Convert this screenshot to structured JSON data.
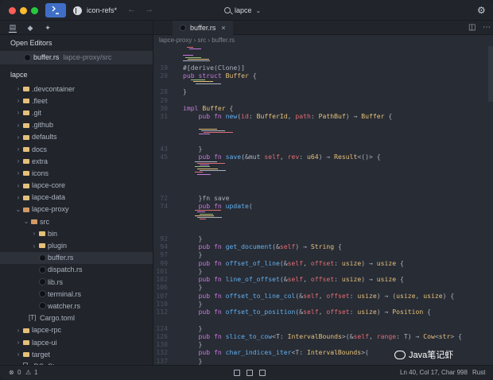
{
  "titlebar": {
    "branch": "icon-refs*",
    "palette_label": "lapce",
    "back_glyph": "←",
    "forward_glyph": "→",
    "settings_glyph": "⚙"
  },
  "sidebar": {
    "tabs": [
      "file-explorer",
      "source-control",
      "plugins"
    ],
    "open_editors_title": "Open Editors",
    "open_editor": {
      "name": "buffer.rs",
      "path": "lapce-proxy/src"
    },
    "root": "lapce",
    "tree": [
      {
        "label": ".devcontainer",
        "kind": "folder",
        "depth": 0,
        "open": false
      },
      {
        "label": ".fleet",
        "kind": "folder",
        "depth": 0,
        "open": false
      },
      {
        "label": ".git",
        "kind": "folder",
        "depth": 0,
        "open": false
      },
      {
        "label": ".github",
        "kind": "folder",
        "depth": 0,
        "open": false
      },
      {
        "label": "defaults",
        "kind": "folder",
        "depth": 0,
        "open": false
      },
      {
        "label": "docs",
        "kind": "folder",
        "depth": 0,
        "open": false
      },
      {
        "label": "extra",
        "kind": "folder",
        "depth": 0,
        "open": false
      },
      {
        "label": "icons",
        "kind": "folder",
        "depth": 0,
        "open": false
      },
      {
        "label": "lapce-core",
        "kind": "folder",
        "depth": 0,
        "open": false
      },
      {
        "label": "lapce-data",
        "kind": "folder",
        "depth": 0,
        "open": false
      },
      {
        "label": "lapce-proxy",
        "kind": "folder",
        "depth": 0,
        "open": true
      },
      {
        "label": "src",
        "kind": "folder",
        "depth": 1,
        "open": true
      },
      {
        "label": "bin",
        "kind": "folder",
        "depth": 2,
        "open": false
      },
      {
        "label": "plugin",
        "kind": "folder",
        "depth": 2,
        "open": false
      },
      {
        "label": "buffer.rs",
        "kind": "rust",
        "depth": 2,
        "selected": true
      },
      {
        "label": "dispatch.rs",
        "kind": "rust",
        "depth": 2
      },
      {
        "label": "lib.rs",
        "kind": "rust",
        "depth": 2
      },
      {
        "label": "terminal.rs",
        "kind": "rust",
        "depth": 2
      },
      {
        "label": "watcher.rs",
        "kind": "rust",
        "depth": 2
      },
      {
        "label": "Cargo.toml",
        "kind": "toml",
        "depth": 1
      },
      {
        "label": "lapce-rpc",
        "kind": "folder",
        "depth": 0,
        "open": false
      },
      {
        "label": "lapce-ui",
        "kind": "folder",
        "depth": 0,
        "open": false
      },
      {
        "label": "target",
        "kind": "folder",
        "depth": 0,
        "open": false
      },
      {
        "label": ".DS_Store",
        "kind": "file",
        "depth": 0
      }
    ]
  },
  "editor": {
    "tab_label": "buffer.rs",
    "close_glyph": "×",
    "breadcrumb": "lapce-proxy › src › buffer.rs",
    "lines": [
      {
        "n": "19",
        "code": [
          [
            "#[derive(Clone)]",
            ""
          ]
        ],
        "row": 2
      },
      {
        "n": "20",
        "code": [
          [
            "pub ",
            "kw"
          ],
          [
            "struct ",
            "kw"
          ],
          [
            "Buffer",
            "ty"
          ],
          [
            " {",
            ""
          ]
        ],
        "row": 3
      },
      {
        "n": "28",
        "code": [
          [
            "}",
            ""
          ]
        ],
        "row": 5
      },
      {
        "n": "29",
        "code": [
          [
            "",
            ""
          ]
        ],
        "row": 6
      },
      {
        "n": "30",
        "code": [
          [
            "impl ",
            "kw"
          ],
          [
            "Buffer",
            "ty"
          ],
          [
            " {",
            ""
          ]
        ],
        "row": 7
      },
      {
        "n": "31",
        "code": [
          [
            "    pub ",
            "kw"
          ],
          [
            "fn ",
            "kw"
          ],
          [
            "new",
            "fn"
          ],
          [
            "(",
            ""
          ],
          [
            "id",
            "pa"
          ],
          [
            ": ",
            ""
          ],
          [
            "BufferId",
            "ty"
          ],
          [
            ", ",
            ""
          ],
          [
            "path",
            "pa"
          ],
          [
            ": ",
            ""
          ],
          [
            "PathBuf",
            "ty"
          ],
          [
            ") → ",
            ""
          ],
          [
            "Buffer",
            "ty"
          ],
          [
            " {",
            ""
          ]
        ],
        "row": 8
      },
      {
        "n": "43",
        "code": [
          [
            "    }",
            ""
          ]
        ],
        "row": 12
      },
      {
        "n": "45",
        "code": [
          [
            "    pub ",
            "kw"
          ],
          [
            "fn ",
            "kw"
          ],
          [
            "save",
            "fn"
          ],
          [
            "(&mut ",
            ""
          ],
          [
            "self",
            "pa"
          ],
          [
            ", ",
            ""
          ],
          [
            "rev",
            "pa"
          ],
          [
            ": ",
            ""
          ],
          [
            "u64",
            "ty"
          ],
          [
            ") → ",
            ""
          ],
          [
            "Result",
            "ty"
          ],
          [
            "<()> {",
            ""
          ]
        ],
        "row": 13
      },
      {
        "n": "72",
        "code": [
          [
            "    }",
            ""
          ],
          [
            "fn save",
            ""
          ]
        ],
        "row": 18
      },
      {
        "n": "74",
        "code": [
          [
            "    pub ",
            "kw"
          ],
          [
            "fn ",
            "kw"
          ],
          [
            "update",
            "fn"
          ],
          [
            "(",
            ""
          ]
        ],
        "row": 19
      },
      {
        "n": "92",
        "code": [
          [
            "    }",
            ""
          ]
        ],
        "row": 23
      },
      {
        "n": "94",
        "code": [
          [
            "    pub ",
            "kw"
          ],
          [
            "fn ",
            "kw"
          ],
          [
            "get_document",
            "fn"
          ],
          [
            "(&",
            ""
          ],
          [
            "self",
            "pa"
          ],
          [
            ") → ",
            ""
          ],
          [
            "String",
            "ty"
          ],
          [
            " {",
            ""
          ]
        ],
        "row": 24
      },
      {
        "n": "97",
        "code": [
          [
            "    }",
            ""
          ]
        ],
        "row": 25
      },
      {
        "n": "99",
        "code": [
          [
            "    pub ",
            "kw"
          ],
          [
            "fn ",
            "kw"
          ],
          [
            "offset_of_line",
            "fn"
          ],
          [
            "(&",
            ""
          ],
          [
            "self",
            "pa"
          ],
          [
            ", ",
            ""
          ],
          [
            "offset",
            "pa"
          ],
          [
            ": ",
            ""
          ],
          [
            "usize",
            "ty"
          ],
          [
            ") → ",
            ""
          ],
          [
            "usize",
            "ty"
          ],
          [
            " {",
            ""
          ]
        ],
        "row": 26
      },
      {
        "n": "101",
        "code": [
          [
            "    }",
            ""
          ]
        ],
        "row": 27
      },
      {
        "n": "102",
        "code": [
          [
            "    pub ",
            "kw"
          ],
          [
            "fn ",
            "kw"
          ],
          [
            "line_of_offset",
            "fn"
          ],
          [
            "(&",
            ""
          ],
          [
            "self",
            "pa"
          ],
          [
            ", ",
            ""
          ],
          [
            "offset",
            "pa"
          ],
          [
            ": ",
            ""
          ],
          [
            "usize",
            "ty"
          ],
          [
            ") → ",
            ""
          ],
          [
            "usize",
            "ty"
          ],
          [
            " {",
            ""
          ]
        ],
        "row": 28
      },
      {
        "n": "106",
        "code": [
          [
            "    }",
            ""
          ]
        ],
        "row": 29
      },
      {
        "n": "107",
        "code": [
          [
            "    pub ",
            "kw"
          ],
          [
            "fn ",
            "kw"
          ],
          [
            "offset_to_line_col",
            "fn"
          ],
          [
            "(&",
            ""
          ],
          [
            "self",
            "pa"
          ],
          [
            ", ",
            ""
          ],
          [
            "offset",
            "pa"
          ],
          [
            ": ",
            ""
          ],
          [
            "usize",
            "ty"
          ],
          [
            ") → (",
            ""
          ],
          [
            "usize",
            "ty"
          ],
          [
            ", ",
            ""
          ],
          [
            "usize",
            "ty"
          ],
          [
            ") {",
            ""
          ]
        ],
        "row": 30
      },
      {
        "n": "110",
        "code": [
          [
            "    }",
            ""
          ]
        ],
        "row": 31
      },
      {
        "n": "112",
        "code": [
          [
            "    pub ",
            "kw"
          ],
          [
            "fn ",
            "kw"
          ],
          [
            "offset_to_position",
            "fn"
          ],
          [
            "(&",
            ""
          ],
          [
            "self",
            "pa"
          ],
          [
            ", ",
            ""
          ],
          [
            "offset",
            "pa"
          ],
          [
            ": ",
            ""
          ],
          [
            "usize",
            "ty"
          ],
          [
            ") → ",
            ""
          ],
          [
            "Position",
            "ty"
          ],
          [
            " {",
            ""
          ]
        ],
        "row": 32
      },
      {
        "n": "124",
        "code": [
          [
            "    }",
            ""
          ]
        ],
        "row": 34
      },
      {
        "n": "126",
        "code": [
          [
            "    pub ",
            "kw"
          ],
          [
            "fn ",
            "kw"
          ],
          [
            "slice_to_cow",
            "fn"
          ],
          [
            "<T: ",
            ""
          ],
          [
            "IntervalBounds",
            "ty"
          ],
          [
            ">(&",
            ""
          ],
          [
            "self",
            "pa"
          ],
          [
            ", ",
            ""
          ],
          [
            "range",
            "pa"
          ],
          [
            ": T) → ",
            ""
          ],
          [
            "Cow",
            "ty"
          ],
          [
            "<",
            ""
          ],
          [
            "str",
            "ty"
          ],
          [
            "> {",
            ""
          ]
        ],
        "row": 35
      },
      {
        "n": "130",
        "code": [
          [
            "    }",
            ""
          ]
        ],
        "row": 36
      },
      {
        "n": "132",
        "code": [
          [
            "    pub ",
            "kw"
          ],
          [
            "fn ",
            "kw"
          ],
          [
            "char_indices_iter",
            "fn"
          ],
          [
            "<T: ",
            ""
          ],
          [
            "IntervalBounds",
            "ty"
          ],
          [
            ">(",
            ""
          ]
        ],
        "row": 37
      },
      {
        "n": "137",
        "code": [
          [
            "    }",
            ""
          ]
        ],
        "row": 38
      },
      {
        "n": "139",
        "code": [
          [
            "    pub ",
            "kw"
          ],
          [
            "fn ",
            "kw"
          ],
          [
            "len",
            "fn"
          ],
          [
            "(&",
            ""
          ],
          [
            "self",
            "pa"
          ],
          [
            ") → ",
            ""
          ],
          [
            "usize",
            "ty"
          ],
          [
            " {",
            ""
          ]
        ],
        "row": 39
      },
      {
        "n": "141",
        "code": [
          [
            "    }",
            ""
          ]
        ],
        "row": 40
      }
    ],
    "inlays": [
      {
        "row": 0,
        "indent": 1,
        "lines": 2
      },
      {
        "row": 1,
        "indent": 0,
        "lines": 4
      },
      {
        "row": 4,
        "indent": 2,
        "lines": 3
      },
      {
        "row": 10,
        "indent": 4,
        "lines": 4
      },
      {
        "row": 14,
        "indent": 3,
        "lines": 8
      },
      {
        "row": 20,
        "indent": 3,
        "lines": 6
      }
    ]
  },
  "statusbar": {
    "errors": "0",
    "warnings": "1",
    "position": "Ln 40, Col 17, Char 998",
    "language": "Rust",
    "error_glyph": "⊗",
    "warning_glyph": "⚠"
  },
  "watermark": {
    "text": "Java笔记虾"
  },
  "colors": {
    "keyword": "#c678dd",
    "type": "#e5c07b",
    "function": "#61afef",
    "param": "#e06c75",
    "accent": "#3f6ec7"
  }
}
